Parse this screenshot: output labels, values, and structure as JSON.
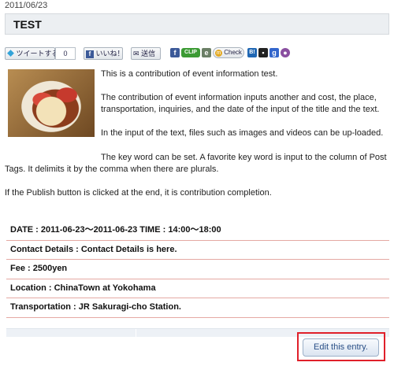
{
  "entry": {
    "date": "2011/06/23",
    "title": "TEST"
  },
  "social": {
    "tweet_label": "ツイートする",
    "tweet_count": "0",
    "like_label": "いいね！",
    "send_label": "送信",
    "clip_label": "CLIP",
    "check_label": "Check"
  },
  "body": {
    "p1": "This is a contribution of event information test.",
    "p2": "The contribution of event information inputs another and cost, the place, transportation, inquiries, and the date of the input of the title and the text.",
    "p3": "In the input of the text, files such as images and videos can be up-loaded.",
    "p4": "The key word can be set. A favorite key word is input to the column of Post Tags. It delimits it by the comma when there are plurals.",
    "p5": "If the Publish button is clicked at the end, it is contribution completion."
  },
  "details": {
    "date_time": "DATE : 2011-06-23～2011-06-23 TIME : 14:00～18:00",
    "contact": "Contact Details : Contact Details is here.",
    "fee": "Fee : 2500yen",
    "location": "Location : ChinaTown at Yokohama",
    "transportation": "Transportation : JR Sakuragi-cho Station."
  },
  "actions": {
    "edit_label": "Edit this entry."
  },
  "colors": {
    "accent": "#e0202a",
    "row_divider": "#e5a9a3",
    "title_bg": "#eceff2"
  }
}
